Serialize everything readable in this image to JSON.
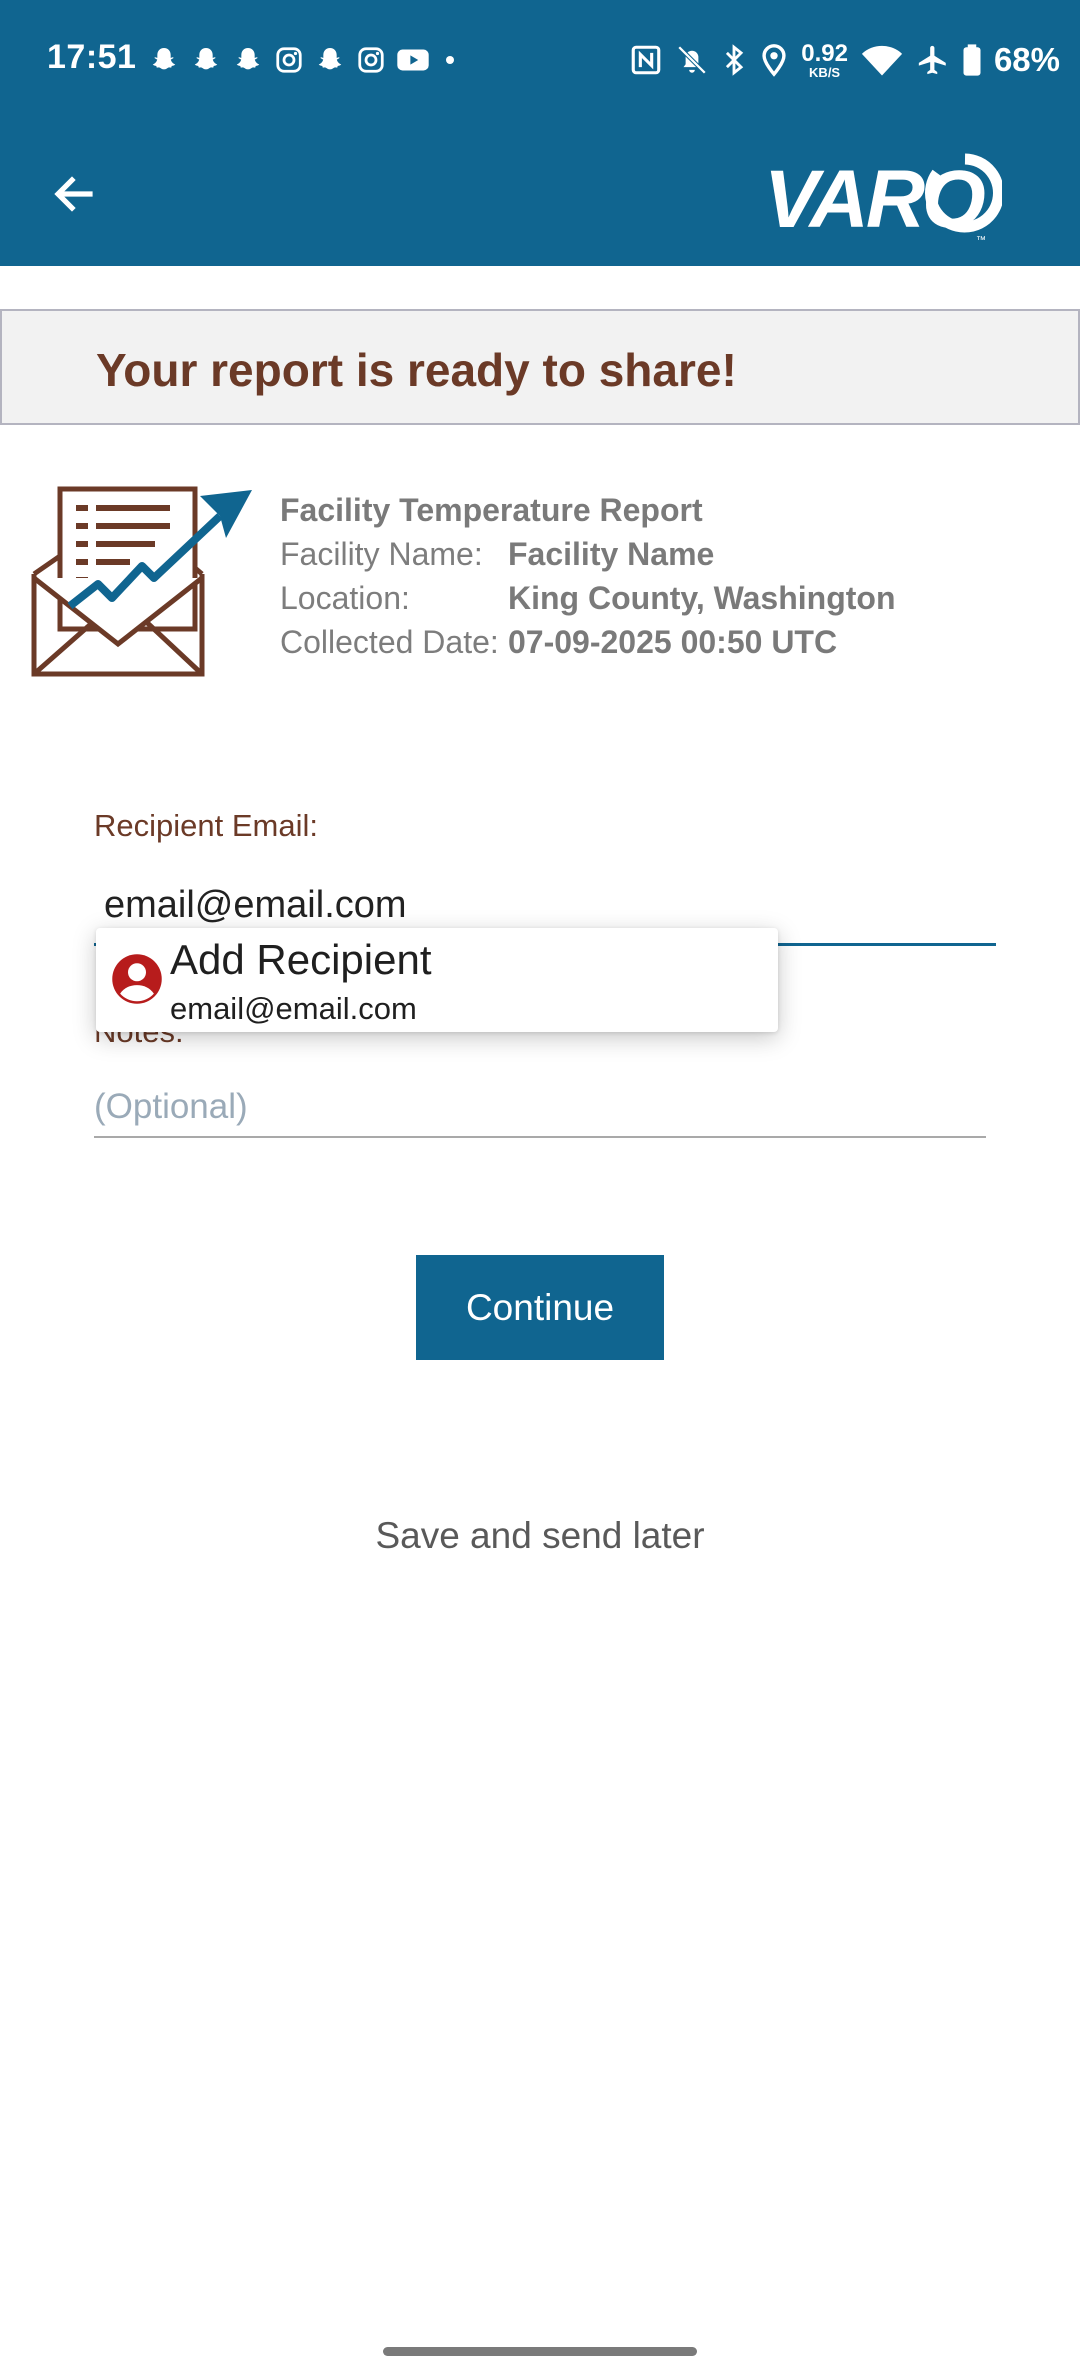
{
  "status_bar": {
    "time": "17:51",
    "left_icons": [
      "snapchat-icon",
      "snapchat-icon",
      "snapchat-icon",
      "instagram-icon",
      "snapchat-icon",
      "instagram-icon",
      "youtube-icon",
      "dot-icon"
    ],
    "network_speed_value": "0.92",
    "network_speed_unit": "KB/S",
    "battery_percent": "68%"
  },
  "appbar": {
    "logo_text": "VARO",
    "logo_mark": "™",
    "color": "#106590"
  },
  "banner": {
    "message": "Your report is ready to share!"
  },
  "report": {
    "title": "Facility Temperature Report",
    "facility_name_label": "Facility Name:",
    "facility_name_value": "Facility Name",
    "location_label": "Location:",
    "location_value": "King County, Washington",
    "collected_date_label": "Collected Date:",
    "collected_date_value": "07-09-2025 00:50 UTC"
  },
  "form": {
    "recipient_label": "Recipient Email:",
    "recipient_value": "email@email.com",
    "notes_label": "Notes:",
    "notes_placeholder": "(Optional)"
  },
  "suggestion": {
    "title": "Add Recipient",
    "subtitle": "email@email.com"
  },
  "actions": {
    "continue_label": "Continue",
    "save_later_label": "Save and send later"
  },
  "colors": {
    "primary": "#106590",
    "brown": "#6b3a27",
    "avatar_red": "#b71c1c"
  }
}
